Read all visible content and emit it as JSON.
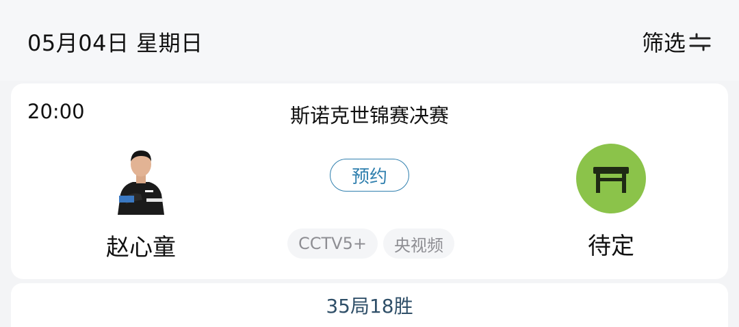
{
  "header": {
    "date": "05月04日 星期日",
    "filter_label": "筛选",
    "filter_icon": "filter-sliders-icon"
  },
  "match": {
    "time": "20:00",
    "title": "斯诺克世锦赛决赛",
    "reserve_label": "预约",
    "channels": [
      "CCTV5+",
      "央视频"
    ],
    "player_left": {
      "name": "赵心童",
      "avatar": "player-photo"
    },
    "player_right": {
      "name": "待定",
      "avatar": "snooker-table-icon",
      "avatar_color": "#8bc34a"
    }
  },
  "footer": {
    "format": "35局18胜"
  },
  "colors": {
    "accent": "#2f7fae",
    "channel_text": "#8e8e93"
  }
}
